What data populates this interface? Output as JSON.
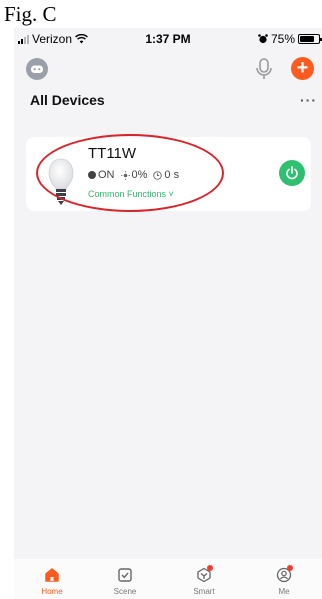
{
  "figure": {
    "caption": "Fig. C"
  },
  "status_bar": {
    "carrier": "Verizon",
    "time": "1:37 PM",
    "battery": "75%",
    "battery_level": 0.75
  },
  "header": {
    "group_title": "All Devices",
    "more_label": "···"
  },
  "device": {
    "name": "TT11W",
    "power_state": "ON",
    "brightness": "0%",
    "timer": "0 s",
    "common_functions": "Common Functions",
    "icon": "light-bulb-icon"
  },
  "tab_bar": {
    "tabs": [
      {
        "label": "Home",
        "icon": "home-icon",
        "active": true
      },
      {
        "label": "Scene",
        "icon": "scene-check-icon",
        "active": false
      },
      {
        "label": "Smart",
        "icon": "smart-cube-icon",
        "active": false
      },
      {
        "label": "Me",
        "icon": "profile-icon",
        "active": false
      }
    ]
  },
  "colors": {
    "accent": "#ff5a1f",
    "power_on": "#2ec06f",
    "annotation": "#d8252a",
    "link_green": "#2fb86b"
  }
}
